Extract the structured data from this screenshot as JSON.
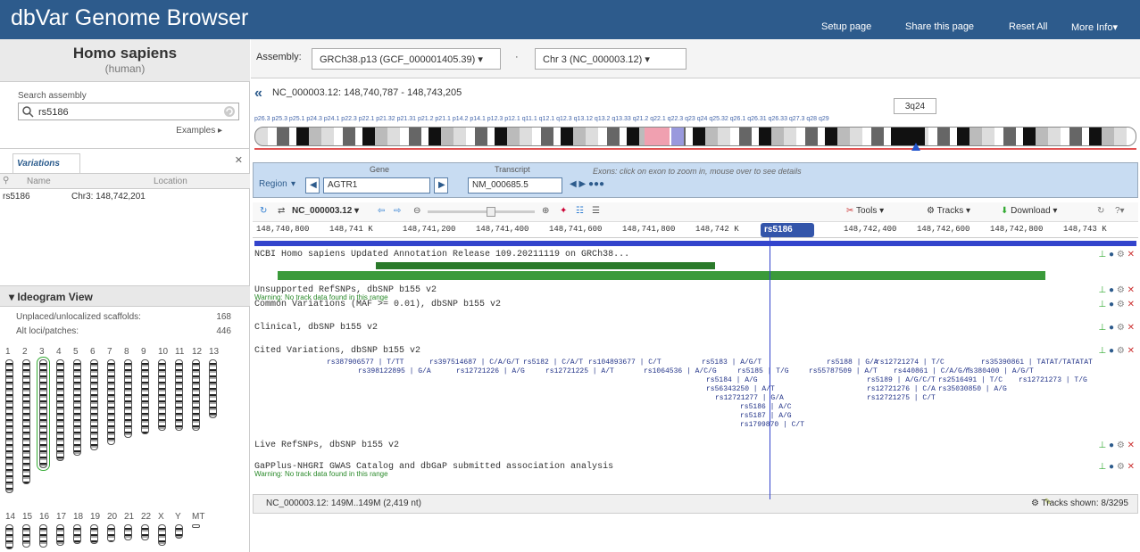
{
  "header": {
    "title": "dbVar Genome Browser",
    "links": [
      "Setup page",
      "Share this page",
      "Reset All",
      "More Info▾"
    ]
  },
  "sidebar": {
    "organism": "Homo sapiens",
    "organism_common": "(human)",
    "search_label": "Search assembly",
    "search_value": "rs5186",
    "examples_label": "Examples ▸",
    "variations_tab": "Variations",
    "columns": [
      "Name",
      "Location"
    ],
    "rows": [
      {
        "name": "rs5186",
        "location": "Chr3: 148,742,201"
      }
    ],
    "ideogram_title": "Ideogram View",
    "unplaced_label": "Unplaced/unlocalized scaffolds:",
    "unplaced_count": "168",
    "altloci_label": "Alt loci/patches:",
    "altloci_count": "446",
    "chr_row1": [
      "1",
      "2",
      "3",
      "4",
      "5",
      "6",
      "7",
      "8",
      "9",
      "10",
      "11",
      "12",
      "13"
    ],
    "chr_row2": [
      "14",
      "15",
      "16",
      "17",
      "18",
      "19",
      "20",
      "21",
      "22",
      "X",
      "Y",
      "MT"
    ]
  },
  "assembly": {
    "label": "Assembly:",
    "value": "GRCh38.p13 (GCF_000001405.39) ▾",
    "chromosome": "Chr 3 (NC_000003.12) ▾"
  },
  "location": "NC_000003.12: 148,740,787 - 148,743,205",
  "band_tooltip": "3q24",
  "band_labels": "p26.3 p25.3 p25.1 p24.3 p24.1 p22.3 p22.1 p21.32 p21.31 p21.2 p21.1 p14.2 p14.1 p12.3 p12.1 q11.1 q12.1 q12.3 q13.12 q13.2 q13.33 q21.2 q22.1 q22.3 q23 q24 q25.32 q26.1 q26.31 q26.33 q27.3 q28 q29",
  "gene_bar": {
    "region_label": "Region",
    "gene_label": "Gene",
    "gene_value": "AGTR1",
    "transcript_label": "Transcript",
    "transcript_value": "NM_000685.5",
    "hint": "Exons: click on exon to zoom in, mouse over to see details"
  },
  "toolbar": {
    "accession": "NC_000003.12 ▾",
    "tools": "Tools ▾",
    "tracks": "Tracks ▾",
    "download": "Download ▾"
  },
  "ruler_ticks": [
    "148,740,800",
    "148,741 K",
    "148,741,200",
    "148,741,400",
    "148,741,600",
    "148,741,800",
    "148,742 K",
    "148,742,400",
    "148,742,600",
    "148,742,800",
    "148,743 K"
  ],
  "cursor_label": "rs5186",
  "tracks": [
    {
      "title": "NCBI Homo sapiens Updated Annotation Release 109.20211119 on GRCh38...",
      "warning": ""
    },
    {
      "title": "Unsupported RefSNPs, dbSNP b155 v2",
      "warning": "Warning: No track data found in this range"
    },
    {
      "title": "Common Variations (MAF >= 0.01), dbSNP b155 v2",
      "warning": ""
    },
    {
      "title": "Clinical, dbSNP b155 v2",
      "warning": ""
    },
    {
      "title": "Cited Variations, dbSNP b155 v2",
      "warning": ""
    },
    {
      "title": "Live RefSNPs, dbSNP b155 v2",
      "warning": ""
    },
    {
      "title": "GaPPlus-NHGRI GWAS Catalog and dbGaP submitted association analysis",
      "warning": "Warning: No track data found in this range"
    }
  ],
  "snp_labels": [
    "rs387906577 | T/TT",
    "rs397514687 | C/A/G/T",
    "rs5182 | C/A/T",
    "rs104893677 | C/T",
    "rs5183 | A/G/T",
    "rs5188 | G/A",
    "rs12721274 | T/C",
    "rs35390861 | TATAT/TATATAT",
    "rs398122895 | G/A",
    "rs12721226 | A/G",
    "rs12721225 | A/T",
    "rs1064536 | A/C/G",
    "rs5185 | T/G",
    "rs55787509 | A/T",
    "rs440861 | C/A/G/T",
    "rs380400 | A/G/T",
    "rs5184 | A/G",
    "rs5189 | A/G/C/T",
    "rs2516491 | T/C",
    "rs12721273 | T/G",
    "rs56343250 | A/T",
    "rs12721276 | C/A",
    "rs35030850 | A/G",
    "rs12721277 | G/A",
    "rs12721275 | C/T",
    "rs5186 | A/C",
    "rs5187 | A/G",
    "rs1799870 | C/T"
  ],
  "status": {
    "range": "NC_000003.12: 149M..149M (2,419 nt)",
    "tracks_shown": "Tracks shown: 8/3295"
  }
}
